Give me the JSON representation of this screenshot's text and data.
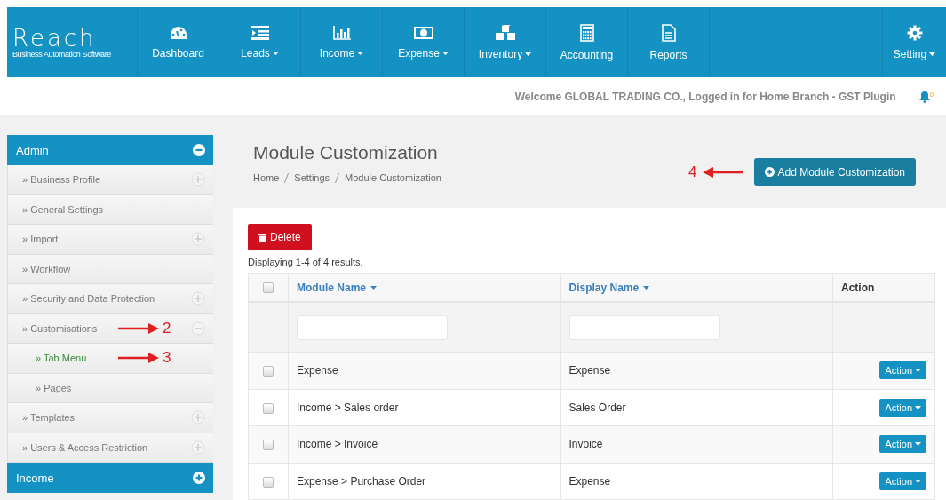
{
  "logo": {
    "name": "Reach",
    "tagline": "Business Automation Software"
  },
  "nav": [
    {
      "label": "Dashboard",
      "dropdown": false
    },
    {
      "label": "Leads",
      "dropdown": true
    },
    {
      "label": "Income",
      "dropdown": true
    },
    {
      "label": "Expense",
      "dropdown": true
    },
    {
      "label": "Inventory",
      "dropdown": true
    },
    {
      "label": "Accounting",
      "dropdown": false
    },
    {
      "label": "Reports",
      "dropdown": false
    }
  ],
  "nav_right": {
    "label": "Setting",
    "dropdown": true
  },
  "welcome": "Welcome GLOBAL TRADING CO., Logged in for Home Branch - GST Plugin",
  "notifications": {
    "count": "0"
  },
  "sidebar": [
    {
      "title": "Admin",
      "expanded": true,
      "items": [
        {
          "label": "» Business Profile",
          "expanded": false,
          "selected": false
        },
        {
          "label": "» General Settings",
          "selected": false
        },
        {
          "label": "» Import",
          "expanded": false,
          "selected": false
        },
        {
          "label": "» Workflow",
          "selected": false
        },
        {
          "label": "» Security and Data Protection",
          "expanded": false,
          "selected": false
        },
        {
          "label": "» Customisations",
          "expanded": true,
          "selected": false,
          "annotation": "2",
          "children": [
            {
              "label": "» Tab Menu",
              "selected": true,
              "annotation": "3"
            },
            {
              "label": "» Pages",
              "selected": false
            }
          ]
        },
        {
          "label": "» Templates",
          "expanded": false,
          "selected": false
        },
        {
          "label": "» Users & Access Restriction",
          "expanded": false,
          "selected": false
        }
      ]
    },
    {
      "title": "Income",
      "expanded": false
    }
  ],
  "page": {
    "title": "Module Customization",
    "breadcrumb": [
      "Home",
      "Settings",
      "Module Customization"
    ],
    "add_button": "Add Module Customization",
    "annotation": "4"
  },
  "delete_button": "Delete",
  "summary": "Displaying 1-4 of 4 results.",
  "table": {
    "select_all_checked": false,
    "columns": [
      {
        "label": "Module Name",
        "sortable": true
      },
      {
        "label": "Display Name",
        "sortable": true
      },
      {
        "label": "Action",
        "sortable": false
      }
    ],
    "rows": [
      {
        "checked": false,
        "module": "Expense",
        "display": "Expense",
        "action": "Action"
      },
      {
        "checked": false,
        "module": "Income > Sales order",
        "display": "Sales Order",
        "action": "Action"
      },
      {
        "checked": false,
        "module": "Income > Invoice",
        "display": "Invoice",
        "action": "Action"
      },
      {
        "checked": false,
        "module": "Expense > Purchase Order",
        "display": "Expense",
        "action": "Action"
      }
    ]
  }
}
